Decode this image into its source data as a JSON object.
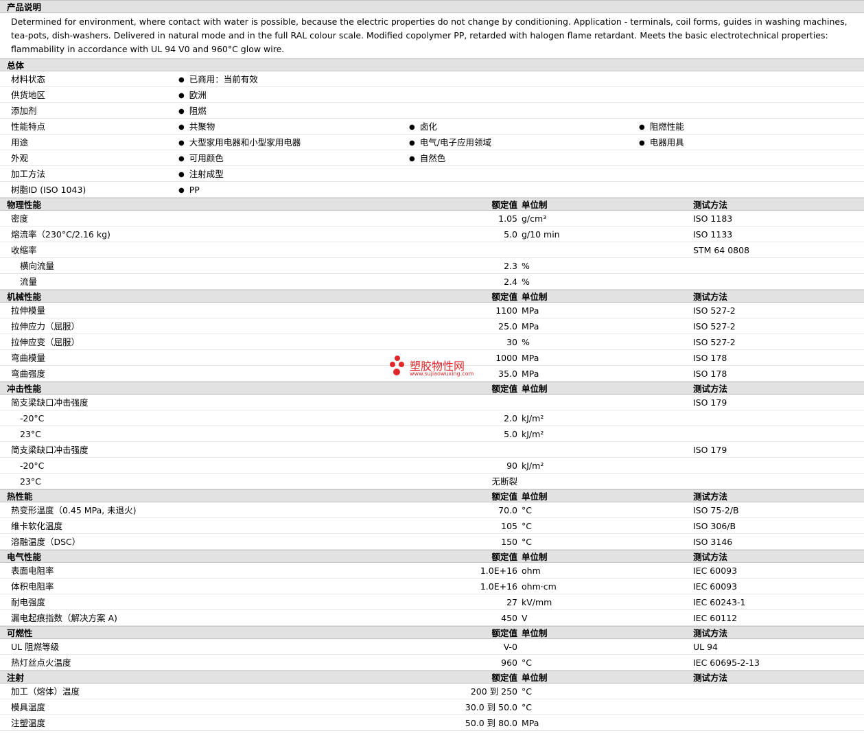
{
  "description": {
    "title": "产品说明",
    "text": "Determined for environment, where contact with water is possible, because the electric properties do not change by conditioning. Application - terminals, coil forms, guides in washing machines, tea-pots, dish-washers. Delivered in natural mode and in the full RAL colour scale. Modified copolymer PP, retarded with halogen flame retardant. Meets the basic electrotechnical properties: flammability in accordance with UL 94 V0 and 960°C glow wire."
  },
  "headers": {
    "value": "额定值",
    "unit": "单位制",
    "test": "测试方法"
  },
  "general": {
    "title": "总体",
    "rows": [
      {
        "label": "材料状态",
        "items": [
          "已商用：当前有效"
        ]
      },
      {
        "label": "供货地区",
        "items": [
          "欧洲"
        ]
      },
      {
        "label": "添加剂",
        "items": [
          "阻燃"
        ]
      },
      {
        "label": "性能特点",
        "items": [
          "共聚物",
          "卤化",
          "阻燃性能"
        ]
      },
      {
        "label": "用途",
        "items": [
          "大型家用电器和小型家用电器",
          "电气/电子应用领域",
          "电器用具"
        ]
      },
      {
        "label": "外观",
        "items": [
          "可用颜色",
          "自然色"
        ]
      },
      {
        "label": "加工方法",
        "items": [
          "注射成型"
        ]
      },
      {
        "label": "树脂ID (ISO 1043)",
        "items": [
          "PP"
        ]
      }
    ]
  },
  "physical": {
    "title": "物理性能",
    "rows": [
      {
        "label": "密度",
        "value": "1.05",
        "unit": "g/cm³",
        "test": "ISO 1183"
      },
      {
        "label": "熔流率（230°C/2.16 kg)",
        "value": "5.0",
        "unit": "g/10 min",
        "test": "ISO 1133"
      },
      {
        "label": "收缩率",
        "value": "",
        "unit": "",
        "test": "STM 64 0808"
      },
      {
        "label": "横向流量",
        "value": "2.3",
        "unit": "%",
        "test": "",
        "sub": true
      },
      {
        "label": "流量",
        "value": "2.4",
        "unit": "%",
        "test": "",
        "sub": true
      }
    ]
  },
  "mechanical": {
    "title": "机械性能",
    "rows": [
      {
        "label": "拉伸模量",
        "value": "1100",
        "unit": "MPa",
        "test": "ISO 527-2"
      },
      {
        "label": "拉伸应力（屈服）",
        "value": "25.0",
        "unit": "MPa",
        "test": "ISO 527-2"
      },
      {
        "label": "拉伸应变（屈服）",
        "value": "30",
        "unit": "%",
        "test": "ISO 527-2"
      },
      {
        "label": "弯曲模量",
        "value": "1000",
        "unit": "MPa",
        "test": "ISO 178"
      },
      {
        "label": "弯曲强度",
        "value": "35.0",
        "unit": "MPa",
        "test": "ISO 178"
      }
    ]
  },
  "impact": {
    "title": "冲击性能",
    "rows": [
      {
        "label": "简支梁缺口冲击强度",
        "value": "",
        "unit": "",
        "test": "ISO 179"
      },
      {
        "label": "-20°C",
        "value": "2.0",
        "unit": "kJ/m²",
        "test": "",
        "sub": true
      },
      {
        "label": "23°C",
        "value": "5.0",
        "unit": "kJ/m²",
        "test": "",
        "sub": true
      },
      {
        "label": "简支梁缺口冲击强度",
        "value": "",
        "unit": "",
        "test": "ISO 179"
      },
      {
        "label": "-20°C",
        "value": "90",
        "unit": "kJ/m²",
        "test": "",
        "sub": true
      },
      {
        "label": "23°C",
        "value": "无断裂",
        "unit": "",
        "test": "",
        "sub": true
      }
    ]
  },
  "thermal": {
    "title": "热性能",
    "rows": [
      {
        "label": "热变形温度（0.45 MPa, 未退火)",
        "value": "70.0",
        "unit": "°C",
        "test": "ISO 75-2/B"
      },
      {
        "label": "维卡软化温度",
        "value": "105",
        "unit": "°C",
        "test": "ISO 306/B"
      },
      {
        "label": "溶融温度（DSC）",
        "value": "150",
        "unit": "°C",
        "test": "ISO 3146"
      }
    ]
  },
  "electrical": {
    "title": "电气性能",
    "rows": [
      {
        "label": "表面电阻率",
        "value": "1.0E+16",
        "unit": "ohm",
        "test": "IEC 60093"
      },
      {
        "label": "体积电阻率",
        "value": "1.0E+16",
        "unit": "ohm·cm",
        "test": "IEC 60093"
      },
      {
        "label": "耐电强度",
        "value": "27",
        "unit": "kV/mm",
        "test": "IEC 60243-1"
      },
      {
        "label": "漏电起痕指数（解决方案 A)",
        "value": "450",
        "unit": "V",
        "test": "IEC 60112"
      }
    ]
  },
  "flammability": {
    "title": "可燃性",
    "rows": [
      {
        "label": "UL 阻燃等级",
        "value": "V-0",
        "unit": "",
        "test": "UL 94"
      },
      {
        "label": "热灯丝点火温度",
        "value": "960",
        "unit": "°C",
        "test": "IEC 60695-2-13"
      }
    ]
  },
  "injection": {
    "title": "注射",
    "rows": [
      {
        "label": "加工（熔体）温度",
        "value": "200 到  250",
        "unit": "°C",
        "test": ""
      },
      {
        "label": "模具温度",
        "value": "30.0 到  50.0",
        "unit": "°C",
        "test": ""
      },
      {
        "label": "注塑温度",
        "value": "50.0 到  80.0",
        "unit": "MPa",
        "test": ""
      }
    ]
  },
  "watermark": {
    "text": "塑胶物性网",
    "url": "www.sujiaowuxing.com",
    "color": "#e0272a"
  }
}
